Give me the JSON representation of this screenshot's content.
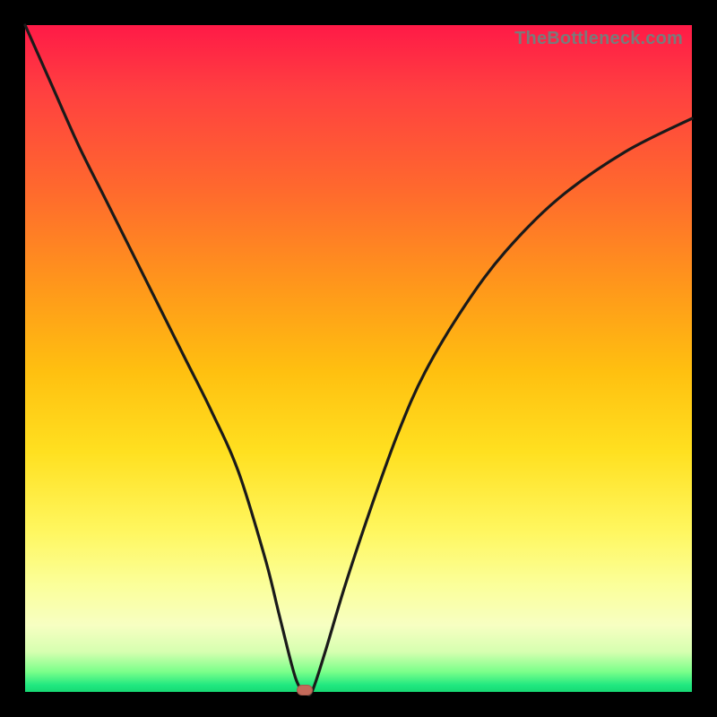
{
  "watermark": "TheBottleneck.com",
  "colors": {
    "frame": "#000000",
    "curve_stroke": "#1a1a1a",
    "marker_fill": "#c46a5a",
    "gradient_top": "#ff1a47",
    "gradient_mid": "#ffe020",
    "gradient_bottom": "#17d873"
  },
  "chart_data": {
    "type": "line",
    "title": "",
    "xlabel": "",
    "ylabel": "",
    "xlim": [
      0,
      100
    ],
    "ylim": [
      0,
      100
    ],
    "note": "V-shaped bottleneck curve. y approaches 0 (green zone) near a single minimum, rises steeply on both sides into red.",
    "series": [
      {
        "name": "bottleneck-curve",
        "x": [
          0,
          4,
          8,
          12,
          16,
          20,
          24,
          28,
          32,
          36,
          38,
          40,
          41,
          42,
          43,
          45,
          48,
          52,
          56,
          60,
          66,
          72,
          80,
          90,
          100
        ],
        "y": [
          100,
          91,
          82,
          74,
          66,
          58,
          50,
          42,
          33,
          20,
          12,
          4,
          1,
          0,
          0,
          6,
          16,
          28,
          39,
          48,
          58,
          66,
          74,
          81,
          86
        ]
      }
    ],
    "marker": {
      "x": 42,
      "y": 0,
      "name": "optimal-point"
    }
  }
}
